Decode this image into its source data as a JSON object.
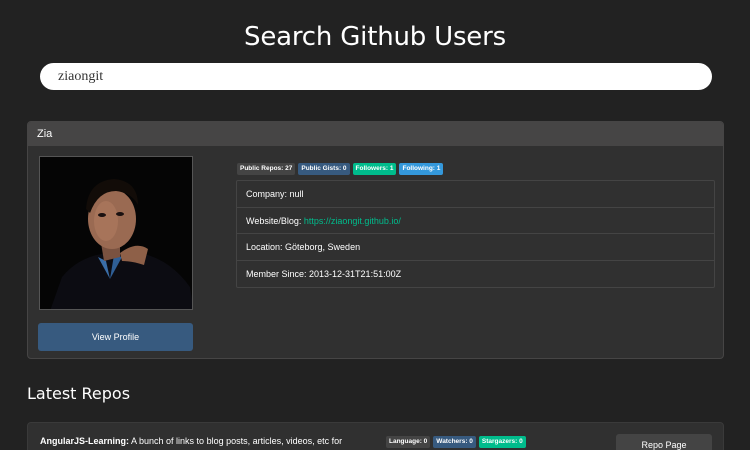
{
  "header": {
    "title": "Search Github Users"
  },
  "search": {
    "value": "ziaongit"
  },
  "user": {
    "name": "Zia",
    "view_profile_label": "View Profile",
    "badges": [
      {
        "label": "Public Repos: 27",
        "color": "#444444"
      },
      {
        "label": "Public Gists: 0",
        "color": "#375a7f"
      },
      {
        "label": "Followers: 1",
        "color": "#00bc8c"
      },
      {
        "label": "Following: 1",
        "color": "#3498db"
      }
    ],
    "company": "Company: null",
    "website_label": "Website/Blog: ",
    "website_url": "https://ziaongit.github.io/",
    "location": "Location: Göteborg, Sweden",
    "member_since": "Member Since: 2013-12-31T21:51:00Z"
  },
  "repos": {
    "title": "Latest Repos",
    "items": [
      {
        "name": "AngularJS-Learning:",
        "description": " A bunch of links to blog posts, articles, videos, etc for",
        "badges": [
          {
            "label": "Language: 0",
            "color": "#444444"
          },
          {
            "label": "Watchers: 0",
            "color": "#375a7f"
          },
          {
            "label": "Stargazers: 0",
            "color": "#00bc8c"
          }
        ],
        "button_label": "Repo Page"
      }
    ]
  }
}
